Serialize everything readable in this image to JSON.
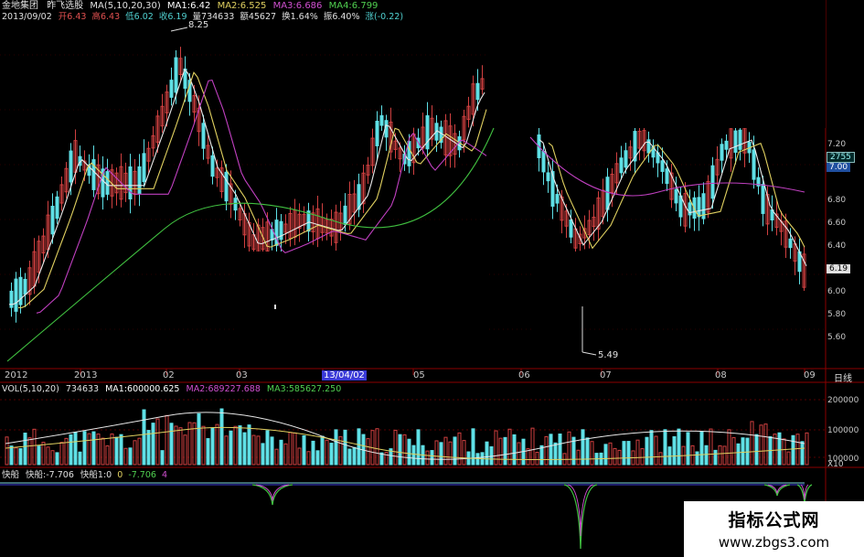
{
  "window": {
    "stock_name": "金地集团",
    "indicator_name": "昨飞选股",
    "ma_legend": [
      "MA(5,10,20,30)",
      "MA1:6.42",
      "MA2:6.525",
      "MA3:6.686",
      "MA4:6.799"
    ],
    "ohlc_line": [
      "2013/09/02",
      "开6.43",
      "高6.43",
      "低6.02",
      "收6.19",
      "量734633",
      "额45627",
      "换1.64%",
      "振6.40%",
      "涨(-0.22)"
    ]
  },
  "price_axis": {
    "ticks": [
      "7.20",
      "7.00",
      "6.80",
      "6.60",
      "6.40",
      "6.20",
      "6.00",
      "5.80",
      "5.60"
    ],
    "high_label": "8.25",
    "low_label": "5.49",
    "current_price": "6.19",
    "badge_top": "2755",
    "badge_bottom": "7.00"
  },
  "time_axis": {
    "labels": [
      "2012",
      "2013",
      "02",
      "03",
      "13/04/02",
      "05",
      "06",
      "07",
      "08",
      "09"
    ],
    "period": "日线"
  },
  "volume_panel": {
    "legend": [
      "VOL(5,10,20)",
      "734633",
      "MA1:600000.625",
      "MA2:689227.688",
      "MA3:585627.250"
    ],
    "ticks": [
      "200000",
      "100000",
      "X10"
    ]
  },
  "indicator_panel": {
    "legend": [
      "快船",
      "快船:-7.706",
      "快船1:0",
      "0",
      "-7.706",
      "4"
    ]
  },
  "watermark": {
    "title": "指标公式网",
    "url": "www.zbgs3.com"
  },
  "colors": {
    "up": "#d04040",
    "down": "#5fe0e6",
    "ma1": "#e8e8e8",
    "ma2": "#e0d060",
    "ma3": "#c040c0",
    "ma4": "#40c040",
    "axis": "#8b0000"
  }
}
